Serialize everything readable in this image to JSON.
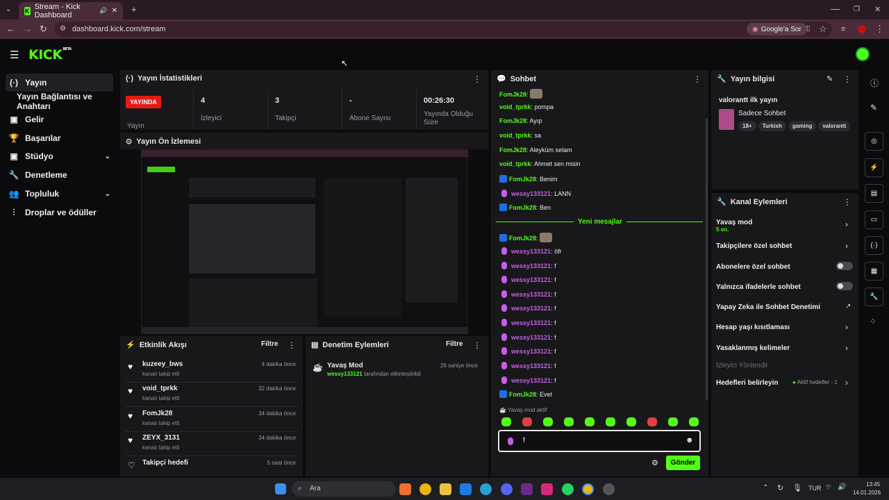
{
  "browser": {
    "tab_title": "Stream - Kick Dashboard",
    "url": "dashboard.kick.com/stream",
    "google_btn": "Google'a Sor"
  },
  "brand": {
    "logo": "KICK",
    "logo_sup": "BETA"
  },
  "sidebar": {
    "items": [
      {
        "icon": "(·)",
        "label": "Yayın"
      },
      {
        "icon": "",
        "label": "Yayın Bağlantısı ve Anahtarı"
      },
      {
        "icon": "▣",
        "label": "Gelir"
      },
      {
        "icon": "🏆",
        "label": "Başarılar"
      },
      {
        "icon": "▣",
        "label": "Stüdyo"
      },
      {
        "icon": "🔧",
        "label": "Denetleme"
      },
      {
        "icon": "👥",
        "label": "Topluluk"
      },
      {
        "icon": "⫶",
        "label": "Droplar ve ödüller"
      }
    ]
  },
  "stats": {
    "title": "Yayın İstatistikleri",
    "live_badge": "YAYINDA",
    "cells": [
      {
        "value": "",
        "label": "Yayın"
      },
      {
        "value": "4",
        "label": "İzleyici"
      },
      {
        "value": "3",
        "label": "Takipçi"
      },
      {
        "value": "-",
        "label": "Abone Sayısı"
      },
      {
        "value": "00:26:30",
        "label": "Yayında Olduğu Süre"
      }
    ]
  },
  "preview": {
    "title": "Yayın Ön İzlemesi"
  },
  "events": {
    "title": "Etkinlik Akışı",
    "filter": "Filtre",
    "rows": [
      {
        "name": "kuzeey_bws",
        "sub": "kanalı takip etti",
        "time": "4 dakika önce"
      },
      {
        "name": "void_tprkk",
        "sub": "kanalı takip etti",
        "time": "32 dakika önce"
      },
      {
        "name": "FomJk28",
        "sub": "kanalı takip etti",
        "time": "34 dakika önce"
      },
      {
        "name": "ZEYX_3131",
        "sub": "kanalı takip etti",
        "time": "34 dakika önce"
      },
      {
        "name": "Takipçi hedefi",
        "sub": "",
        "time": "5 saat önce"
      }
    ]
  },
  "moderation": {
    "title": "Denetim Eylemleri",
    "filter": "Filtre",
    "item_title": "Yavaş Mod",
    "item_user": "wessy133121",
    "item_desc": " tarafından etkinleştirildi",
    "item_time": "26 saniye önce"
  },
  "chat": {
    "title": "Sohbet",
    "new_messages": "Yeni mesajlar",
    "slow_mode": "Yavaş mod aktif",
    "input_value": "f",
    "send": "Gönder",
    "colors": {
      "green": "#53fc18",
      "purple": "#c85ee8",
      "blue": "#1d6fe0"
    },
    "messages": [
      {
        "user": "FomJk28",
        "text": "",
        "emote": true,
        "badge": "none"
      },
      {
        "user": "void_tprkk",
        "text": "pompa",
        "badge": "none"
      },
      {
        "user": "FomJk28",
        "text": "Ayıp",
        "badge": "none"
      },
      {
        "user": "void_tprkk",
        "text": "sa",
        "badge": "none"
      },
      {
        "user": "FomJk28",
        "text": "Aleyküm selam",
        "badge": "none"
      },
      {
        "user": "void_tprkk",
        "text": "Ahmet sen misin",
        "badge": "none"
      },
      {
        "user": "FomJk28",
        "text": "Benim",
        "badge": "kick"
      },
      {
        "user": "wessy133121",
        "text": "LANN",
        "badge": "mic"
      },
      {
        "user": "FomJk28",
        "text": "Ben",
        "badge": "kick"
      },
      {
        "user": "FomJk28",
        "text": "",
        "emote": true,
        "badge": "kick"
      },
      {
        "user": "wessy133121",
        "text": "öfr",
        "badge": "mic"
      },
      {
        "user": "wessy133121",
        "text": "f",
        "badge": "mic"
      },
      {
        "user": "wessy133121",
        "text": "f",
        "badge": "mic"
      },
      {
        "user": "wessy133121",
        "text": "f",
        "badge": "mic"
      },
      {
        "user": "wessy133121",
        "text": "f",
        "badge": "mic"
      },
      {
        "user": "wessy133121",
        "text": "f",
        "badge": "mic"
      },
      {
        "user": "wessy133121",
        "text": "f",
        "badge": "mic"
      },
      {
        "user": "wessy133121",
        "text": "f",
        "badge": "mic"
      },
      {
        "user": "wessy133121",
        "text": "f",
        "badge": "mic"
      },
      {
        "user": "wessy133121",
        "text": "f",
        "badge": "mic"
      },
      {
        "user": "FomJk28",
        "text": "Evet",
        "badge": "kick"
      }
    ]
  },
  "stream_info": {
    "title": "Yayın bilgisi",
    "stream_title": "valorantt ilk yayın",
    "category": "Sadece Sohbet",
    "tags": [
      "18+",
      "Turkish",
      "gaming",
      "valorantt"
    ]
  },
  "channel_actions": {
    "title": "Kanal Eylemleri",
    "slow_label": "Yavaş mod",
    "slow_sub": "5 sn.",
    "followers": "Takipçilere özel sohbet",
    "subscribers": "Abonelere özel sohbet",
    "emotes": "Yalnızca ifadelerle sohbet",
    "ai": "Yapay Zeka ile Sohbet Denetimi",
    "age": "Hesap yaşı kısıtlaması",
    "banned_words": "Yasaklanmış kelimeler",
    "viewer_dir": "İzleyici Yönlendir",
    "goals": "Hedefleri belirleyin",
    "goals_sub": "Aktif hedefler - 1"
  },
  "taskbar": {
    "search": "Ara",
    "lang": "TUR",
    "time": "13:45",
    "date": "14.01.2026"
  }
}
